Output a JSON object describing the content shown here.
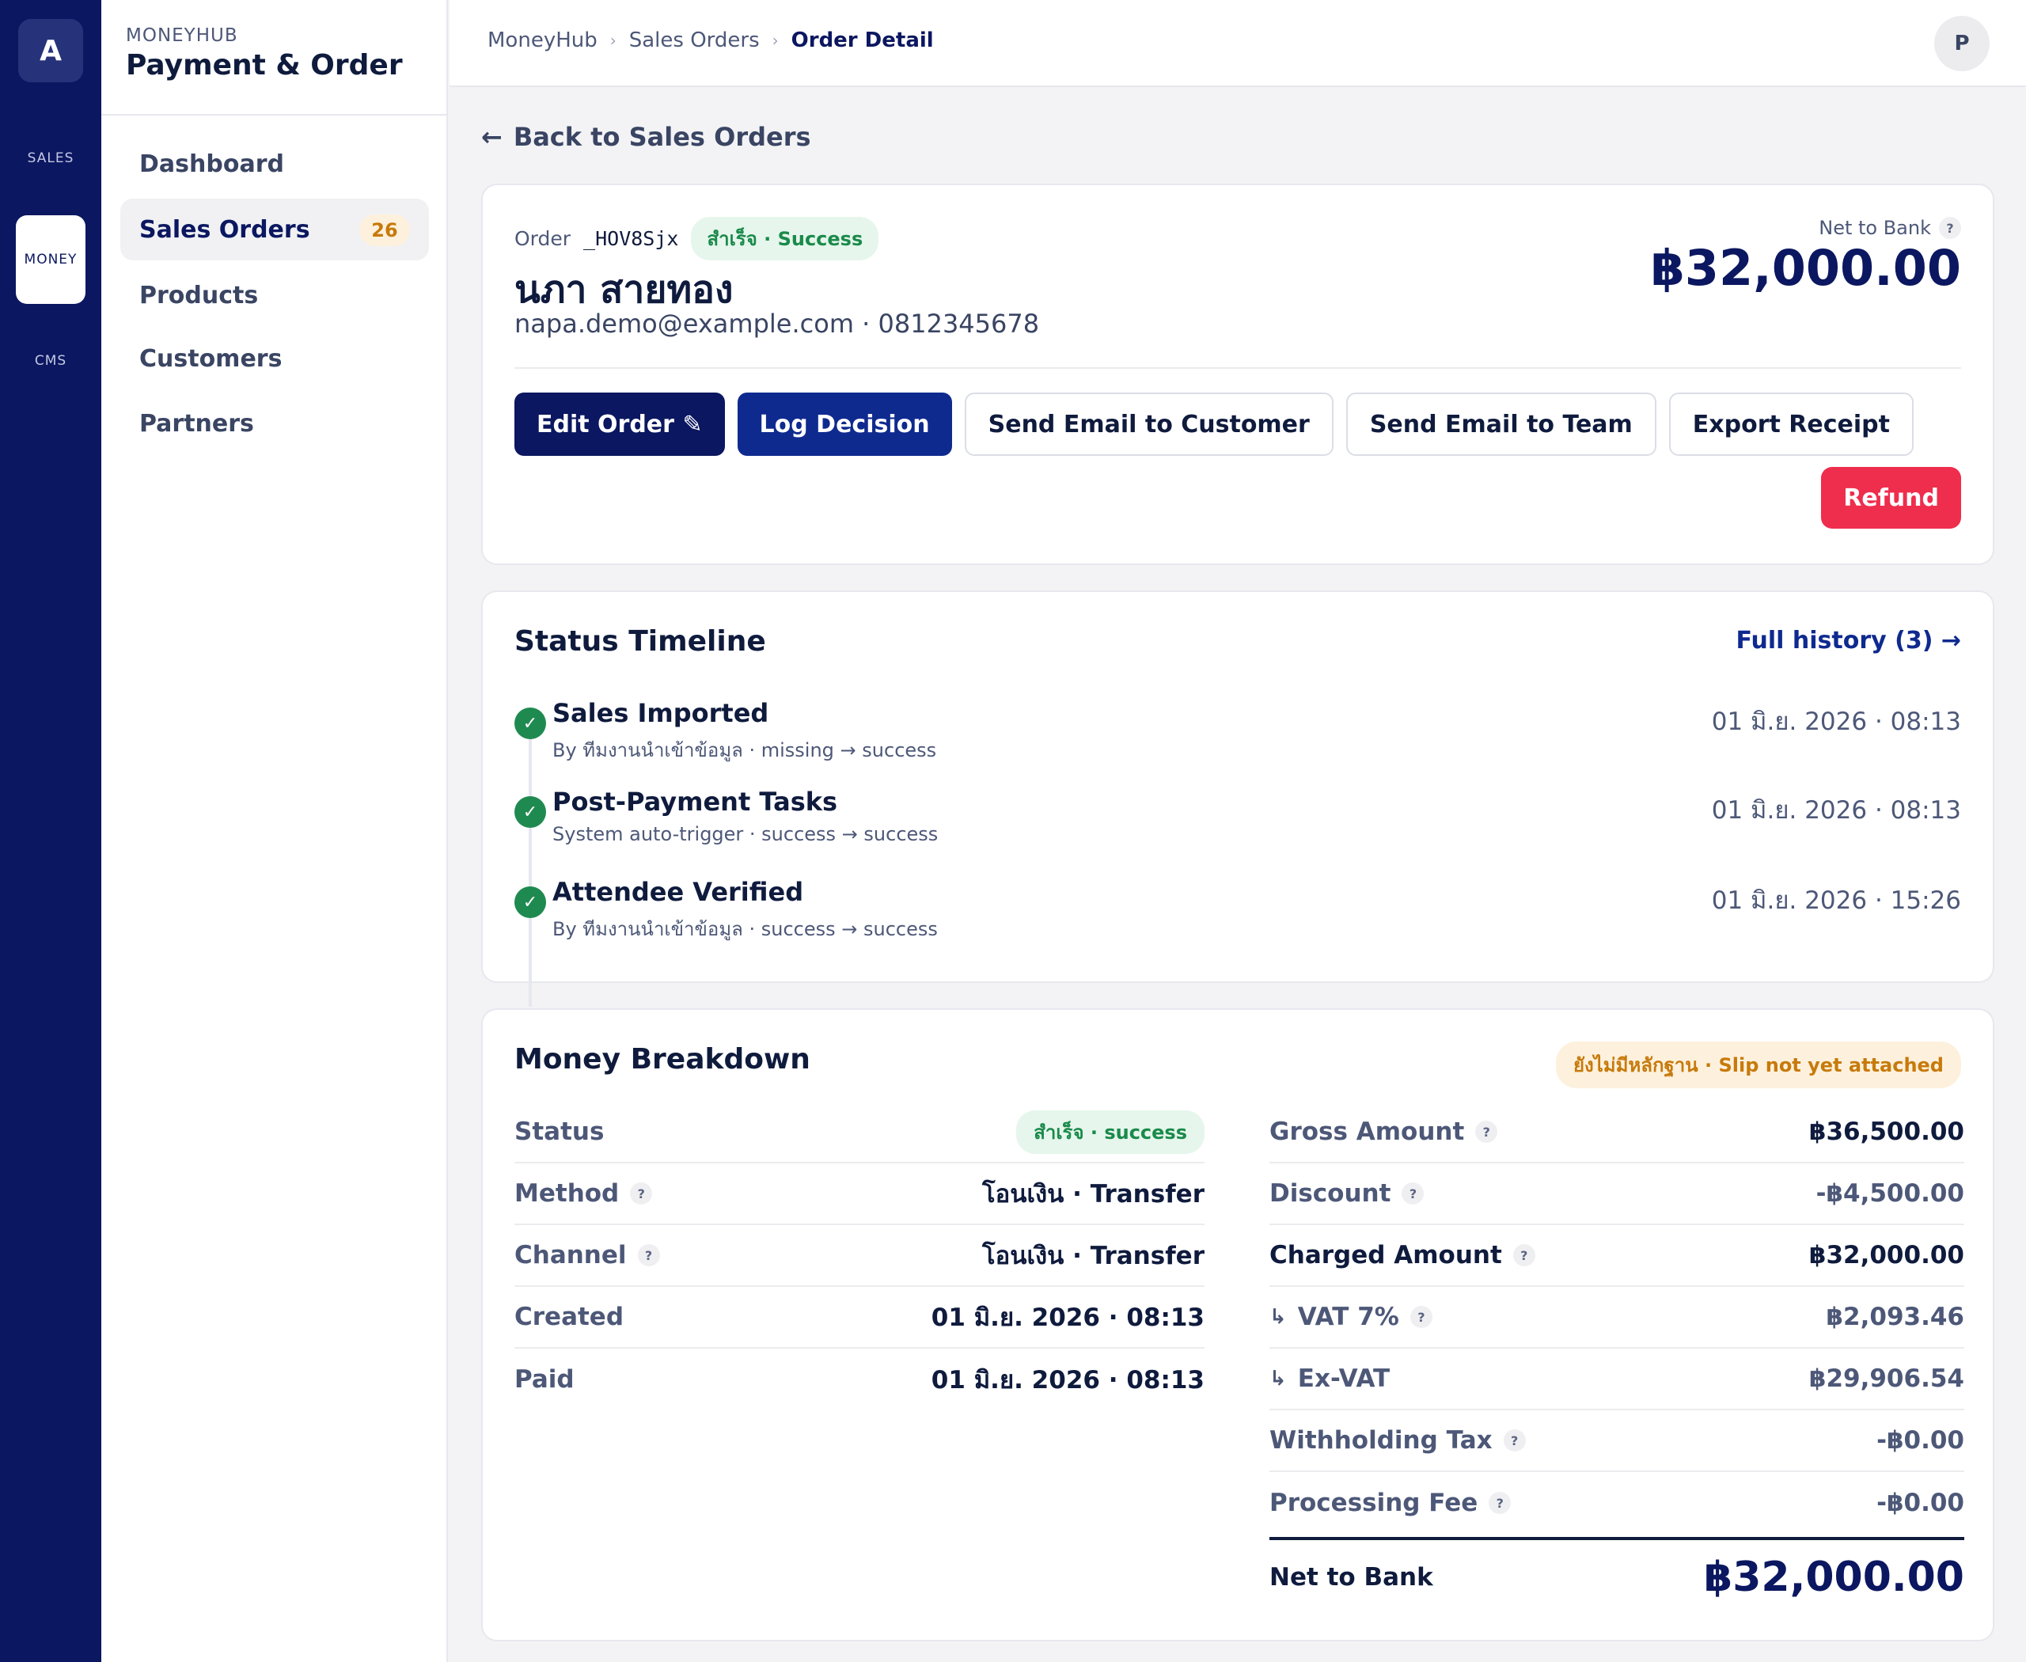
{
  "rail": {
    "logo": "A",
    "items": [
      {
        "label": "SALES",
        "active": false
      },
      {
        "label": "MONEY",
        "active": true
      },
      {
        "label": "CMS",
        "active": false
      }
    ]
  },
  "sidebar": {
    "kicker": "MONEYHUB",
    "title": "Payment & Order",
    "items": [
      {
        "label": "Dashboard"
      },
      {
        "label": "Sales Orders",
        "badge": "26"
      },
      {
        "label": "Products"
      },
      {
        "label": "Customers"
      },
      {
        "label": "Partners"
      }
    ]
  },
  "topbar": {
    "crumbs": [
      "MoneyHub",
      "Sales Orders",
      "Order Detail"
    ],
    "avatar": "P"
  },
  "back_label": "Back to Sales Orders",
  "order": {
    "prefix": "Order",
    "id": "_HOV8Sjx",
    "status": "สำเร็จ · Success",
    "customer_name": "นภา สายทอง",
    "contact": "napa.demo@example.com · 0812345678",
    "net_label": "Net to Bank",
    "net_amount": "฿32,000.00",
    "actions": {
      "edit": "Edit Order ✎",
      "log": "Log Decision",
      "email_customer": "Send Email to Customer",
      "email_team": "Send Email to Team",
      "export": "Export Receipt",
      "refund": "Refund"
    }
  },
  "timeline": {
    "title": "Status Timeline",
    "history_link": "Full history (3) →",
    "events": [
      {
        "title": "Sales Imported",
        "sub": "By ทีมงานนำเข้าข้อมูล · missing → success",
        "time": "01 มิ.ย. 2026 · 08:13"
      },
      {
        "title": "Post-Payment Tasks",
        "sub": "System auto-trigger · success → success",
        "time": "01 มิ.ย. 2026 · 08:13"
      },
      {
        "title": "Attendee Verified",
        "sub": "By ทีมงานนำเข้าข้อมูล · success → success",
        "time": "01 มิ.ย. 2026 · 15:26"
      }
    ]
  },
  "breakdown": {
    "title": "Money Breakdown",
    "slip_status": "ยังไม่มีหลักฐาน · Slip not yet attached",
    "left": {
      "status_label": "Status",
      "status_value": "สำเร็จ · success",
      "method_label": "Method",
      "method_value": "โอนเงิน · Transfer",
      "channel_label": "Channel",
      "channel_value": "โอนเงิน · Transfer",
      "created_label": "Created",
      "created_value": "01 มิ.ย. 2026 · 08:13",
      "paid_label": "Paid",
      "paid_value": "01 มิ.ย. 2026 · 08:13"
    },
    "right": {
      "gross_label": "Gross Amount",
      "gross_value": "฿36,500.00",
      "discount_label": "Discount",
      "discount_value": "-฿4,500.00",
      "charged_label": "Charged Amount",
      "charged_value": "฿32,000.00",
      "vat_label": "VAT 7%",
      "vat_value": "฿2,093.46",
      "exvat_label": "Ex-VAT",
      "exvat_value": "฿29,906.54",
      "wht_label": "Withholding Tax",
      "wht_value": "-฿0.00",
      "fee_label": "Processing Fee",
      "fee_value": "-฿0.00",
      "net_label": "Net to Bank",
      "net_value": "฿32,000.00"
    }
  },
  "icons": {
    "help": "?",
    "check": "✓",
    "back_arrow": "←",
    "sub_arrow": "↳",
    "crumb_sep": "›"
  }
}
